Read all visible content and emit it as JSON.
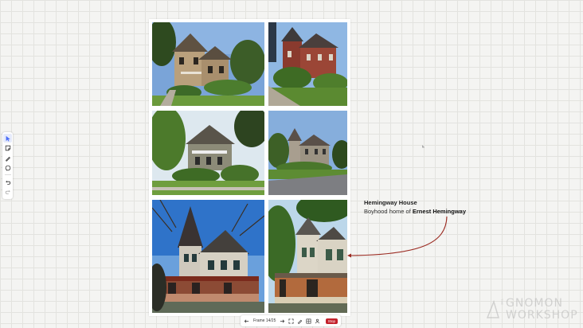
{
  "tools": [
    {
      "icon": "cursor-arrow-icon",
      "active": true
    },
    {
      "icon": "sticky-note-icon",
      "active": false
    },
    {
      "icon": "pen-icon",
      "active": false
    },
    {
      "icon": "comment-icon",
      "active": false
    },
    {
      "icon": "undo-icon",
      "active": false
    },
    {
      "icon": "redo-icon",
      "active": false
    }
  ],
  "annotation": {
    "title": "Hemingway House",
    "subtitle_prefix": "Boyhood home of ",
    "subtitle_bold": "Ernest Hemingway"
  },
  "presentation": {
    "frame_label": "Frame 14/25",
    "stop_label": "Stop"
  },
  "watermark": {
    "the": "THE",
    "line1": "GNOMON",
    "line2": "WORKSHOP"
  },
  "colors": {
    "accent": "#c3212b",
    "arrow": "#9b2b22",
    "active_tool": "#4a6cf7"
  }
}
